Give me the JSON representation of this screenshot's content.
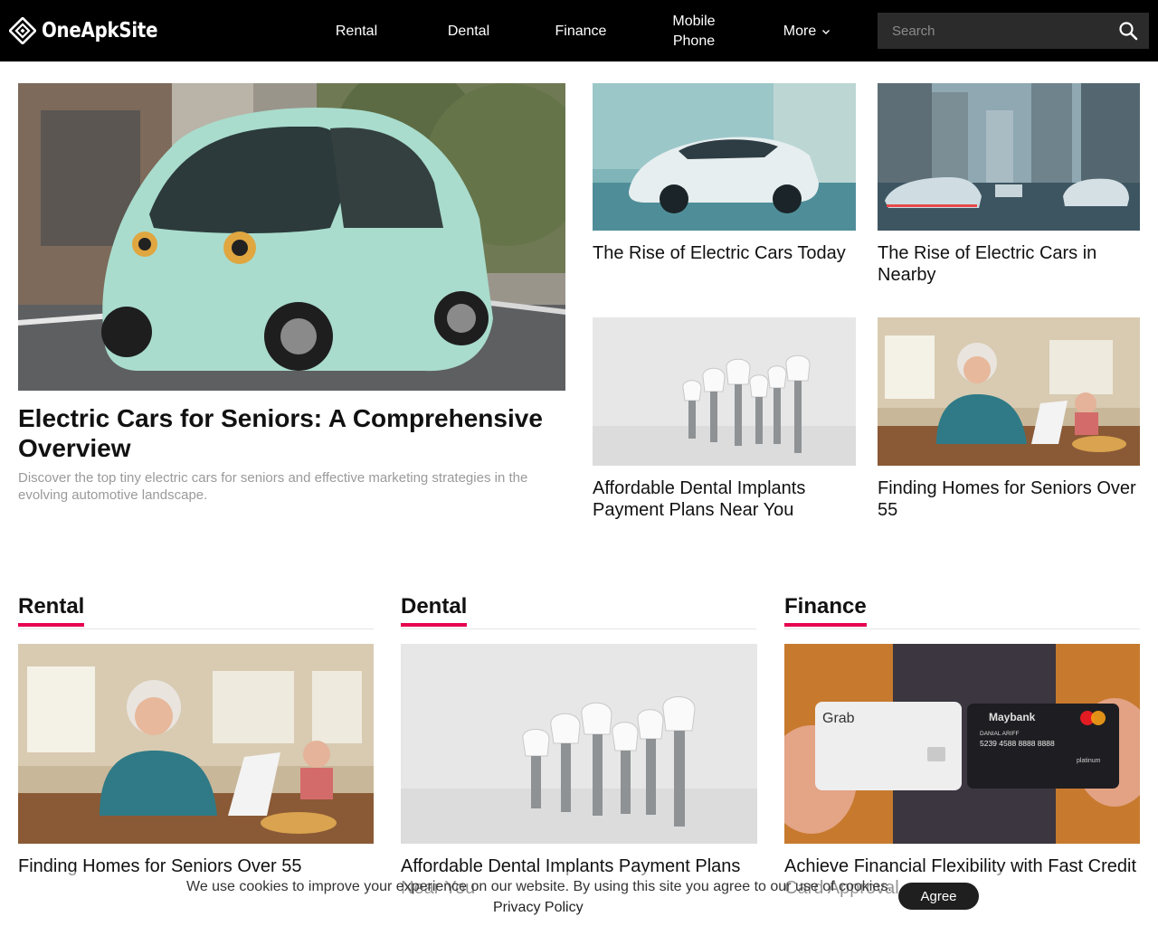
{
  "header": {
    "logo_text": "OneApkSite",
    "nav": {
      "rental": "Rental",
      "dental": "Dental",
      "finance": "Finance",
      "mobile_line1": "Mobile",
      "mobile_line2": "Phone",
      "more": "More"
    },
    "search_placeholder": "Search"
  },
  "hero": {
    "title": "Electric Cars for Seniors: A Comprehensive Overview",
    "description": "Discover the top tiny electric cars for seniors and effective marketing strategies in the evolving automotive landscape."
  },
  "grid_cards": [
    {
      "title": "The Rise of Electric Cars Today"
    },
    {
      "title": "The Rise of Electric Cars in Nearby"
    },
    {
      "title": "Affordable Dental Implants Payment Plans Near You"
    },
    {
      "title": "Finding Homes for Seniors Over 55"
    }
  ],
  "sections": [
    {
      "label": "Rental",
      "article_title": "Finding Homes for Seniors Over 55"
    },
    {
      "label": "Dental",
      "article_title": "Affordable Dental Implants Payment Plans Near You"
    },
    {
      "label": "Finance",
      "article_title": "Achieve Financial Flexibility with Fast Credit Card Approval"
    }
  ],
  "image_text": {
    "card_brand_1": "Grab",
    "card_brand_2": "Maybank",
    "card_holder": "DANIAL ARIFF",
    "card_number": "5239  4588  8888  8888",
    "card_tier": "platinum"
  },
  "cookie": {
    "message": "We use cookies to improve your experience on our website. By using this site you agree to our use of cookies.",
    "privacy_link": "Privacy Policy",
    "agree_label": "Agree"
  },
  "colors": {
    "header_bg": "#000000",
    "accent": "#e6004f",
    "search_bg": "#2b2b2b",
    "muted_text": "#9a9a9a"
  }
}
